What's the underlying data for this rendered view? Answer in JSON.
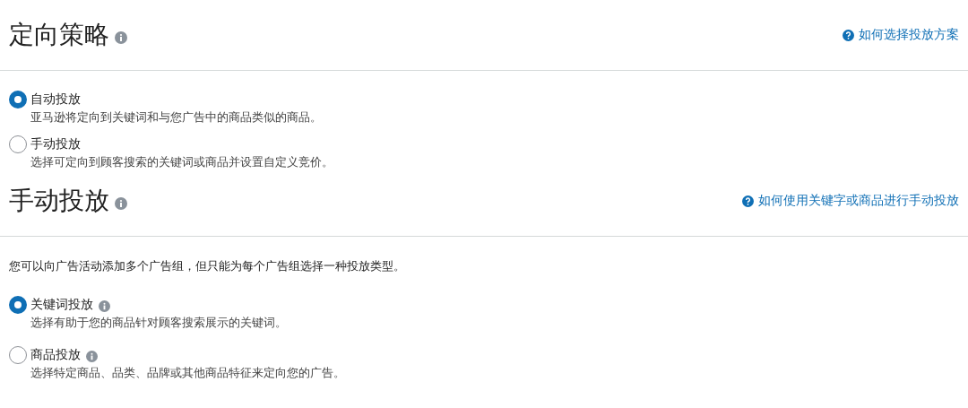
{
  "sections": [
    {
      "title": "定向策略",
      "help_link": "如何选择投放方案",
      "options": [
        {
          "label": "自动投放",
          "description": "亚马逊将定向到关键词和与您广告中的商品类似的商品。",
          "selected": true,
          "info": false
        },
        {
          "label": "手动投放",
          "description": "选择可定向到顾客搜索的关键词或商品并设置自定义竞价。",
          "selected": false,
          "info": false
        }
      ]
    },
    {
      "title": "手动投放",
      "help_link": "如何使用关键字或商品进行手动投放",
      "intro": "您可以向广告活动添加多个广告组，但只能为每个广告组选择一种投放类型。",
      "options": [
        {
          "label": "关键词投放",
          "description": "选择有助于您的商品针对顾客搜索展示的关键词。",
          "selected": true,
          "info": true
        },
        {
          "label": "商品投放",
          "description": "选择特定商品、品类、品牌或其他商品特征来定向您的广告。",
          "selected": false,
          "info": true
        }
      ]
    }
  ]
}
